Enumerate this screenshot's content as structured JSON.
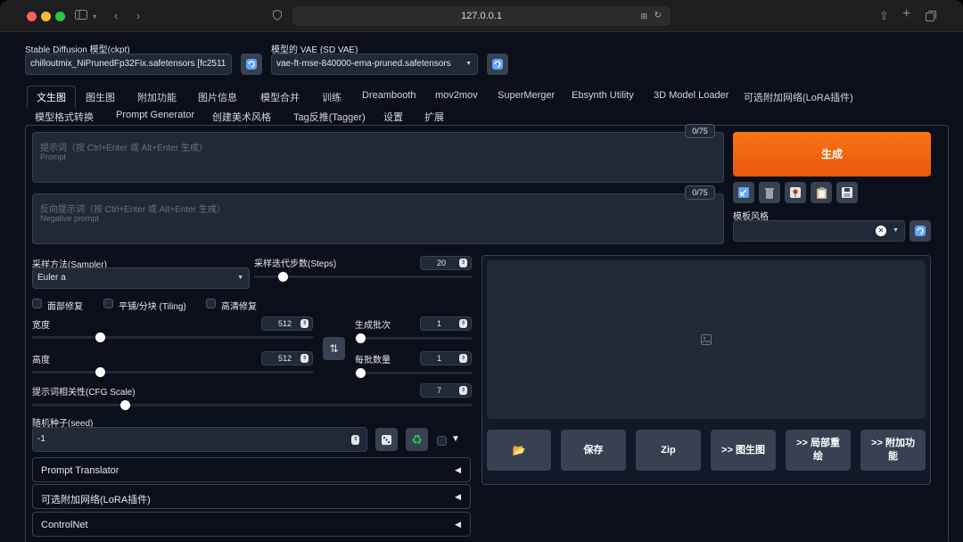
{
  "browser": {
    "url": "127.0.0.1"
  },
  "model": {
    "ckpt_label": "Stable Diffusion 模型(ckpt)",
    "ckpt_value": "chilloutmix_NiPrunedFp32Fix.safetensors [fc2511",
    "vae_label": "模型的 VAE (SD VAE)",
    "vae_value": "vae-ft-mse-840000-ema-pruned.safetensors"
  },
  "tabs": {
    "row1": [
      "文生图",
      "图生图",
      "附加功能",
      "图片信息",
      "模型合并",
      "训练",
      "Dreambooth",
      "mov2mov",
      "SuperMerger",
      "Ebsynth Utility",
      "3D Model Loader",
      "可选附加网络(LoRA插件)"
    ],
    "row2": [
      "模型格式转换",
      "Prompt Generator",
      "创建美术风格",
      "Tag反推(Tagger)",
      "设置",
      "扩展"
    ]
  },
  "prompt": {
    "placeholder1": "提示词（按 Ctrl+Enter 或 Alt+Enter 生成）",
    "placeholder2": "Prompt",
    "counter": "0/75"
  },
  "negative": {
    "placeholder1": "反向提示词（按 Ctrl+Enter 或 Alt+Enter 生成）",
    "placeholder2": "Negative prompt",
    "counter": "0/75"
  },
  "generate_label": "生成",
  "style": {
    "label": "模板风格"
  },
  "sampler": {
    "label": "采样方法(Sampler)",
    "value": "Euler a"
  },
  "steps": {
    "label": "采样迭代步数(Steps)",
    "value": "20",
    "fraction": 0.13
  },
  "checkboxes": {
    "face": "面部修复",
    "tiling": "平铺/分块 (Tiling)",
    "hires": "高清修复"
  },
  "width": {
    "label": "宽度",
    "value": "512",
    "fraction": 0.24
  },
  "height": {
    "label": "高度",
    "value": "512",
    "fraction": 0.24
  },
  "batch_count": {
    "label": "生成批次",
    "value": "1",
    "fraction": 0.0
  },
  "batch_size": {
    "label": "每批数量",
    "value": "1",
    "fraction": 0.0
  },
  "cfg": {
    "label": "提示词相关性(CFG Scale)",
    "value": "7",
    "fraction": 0.21
  },
  "seed": {
    "label": "随机种子(seed)",
    "value": "-1"
  },
  "actions": {
    "save": "保存",
    "zip": "Zip",
    "img2img": ">> 图生图",
    "inpaint": ">> 局部重绘",
    "extras": ">> 附加功能"
  },
  "accordions": [
    "Prompt Translator",
    "可选附加网络(LoRA插件)",
    "ControlNet"
  ],
  "colors": {
    "accent": "#f97316",
    "background": "#0b0f19",
    "surface": "#1f2937"
  }
}
